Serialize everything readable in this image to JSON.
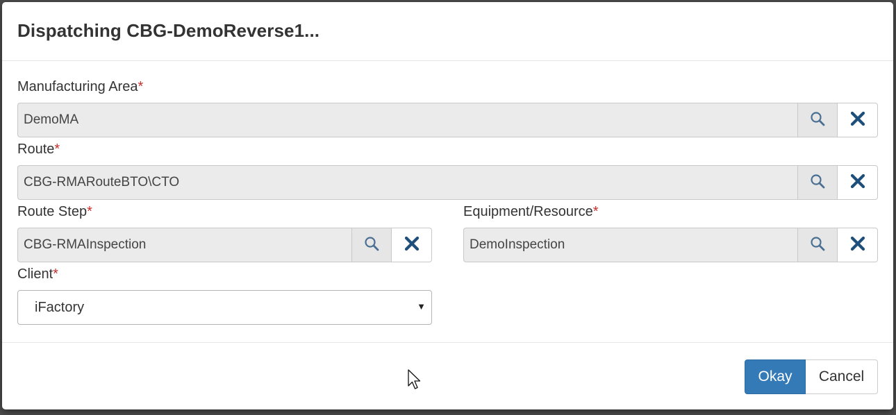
{
  "dialog": {
    "title": "Dispatching CBG-DemoReverse1..."
  },
  "fields": {
    "manufacturing_area": {
      "label": "Manufacturing Area",
      "required_mark": "*",
      "value": "DemoMA"
    },
    "route": {
      "label": "Route",
      "required_mark": "*",
      "value": "CBG-RMARouteBTO\\CTO"
    },
    "route_step": {
      "label": "Route Step",
      "required_mark": "*",
      "value": "CBG-RMAInspection"
    },
    "equipment_resource": {
      "label": "Equipment/Resource",
      "required_mark": "*",
      "value": "DemoInspection"
    },
    "client": {
      "label": "Client",
      "required_mark": "*",
      "selected": "iFactory"
    }
  },
  "footer": {
    "okay_label": "Okay",
    "cancel_label": "Cancel"
  },
  "colors": {
    "primary": "#337ab7",
    "required": "#c9302c",
    "icon": "#4a6f92",
    "clear_icon": "#1e4f7a"
  },
  "icons": {
    "search": "search-icon",
    "clear": "close-icon",
    "dropdown": "caret-down-icon",
    "pointer": "mouse-cursor-icon"
  }
}
